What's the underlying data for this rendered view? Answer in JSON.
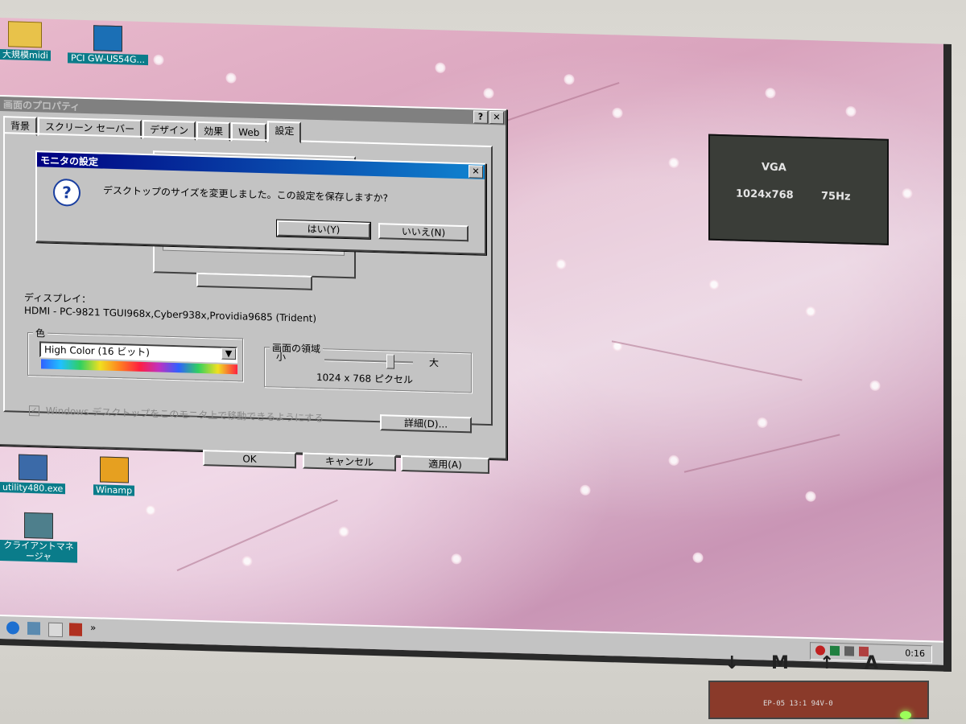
{
  "desktop": {
    "icons": [
      {
        "label": "大規模midi"
      },
      {
        "label": "PCI GW-US54G..."
      },
      {
        "label": "utility480.exe"
      },
      {
        "label": "Winamp"
      },
      {
        "label": "クライアントマネージャ"
      }
    ]
  },
  "properties_window": {
    "title": "画面のプロパティ",
    "help_button": "?",
    "close_button": "✕",
    "tabs": [
      "背景",
      "スクリーン セーバー",
      "デザイン",
      "効果",
      "Web",
      "設定"
    ],
    "selected_tab": "設定",
    "display_label": "ディスプレイ：",
    "display_value": "HDMI - PC-9821 TGUI968x,Cyber938x,Providia9685 (Trident)",
    "color_group_label": "色",
    "color_select_value": "High Color (16 ビット)",
    "area_group_label": "画面の領域",
    "slider_min_label": "小",
    "slider_max_label": "大",
    "resolution_text": "1024 x 768 ピクセル",
    "slider_position": 0.75,
    "extend_checkbox_label": "Windows デスクトップをこのモニタ上で移動できるようにする",
    "details_button": "詳細(D)...",
    "ok_button": "OK",
    "cancel_button": "キャンセル",
    "apply_button": "適用(A)"
  },
  "monitor_dialog": {
    "title": "モニタの設定",
    "close_button": "✕",
    "message": "デスクトップのサイズを変更しました。この設定を保存しますか?",
    "yes_button": "はい(Y)",
    "no_button": "いいえ(N)",
    "icon": "question-icon"
  },
  "taskbar": {
    "quicklaunch_more": "»",
    "clock": "0:16"
  },
  "osd": {
    "line1": "VGA",
    "line2_resolution": "1024x768",
    "line2_refresh": "75Hz"
  },
  "monitor_front": {
    "buttons": [
      "↓",
      "M",
      "↑",
      "A"
    ],
    "panel_text": "EP-05  13:1  94V-0"
  }
}
